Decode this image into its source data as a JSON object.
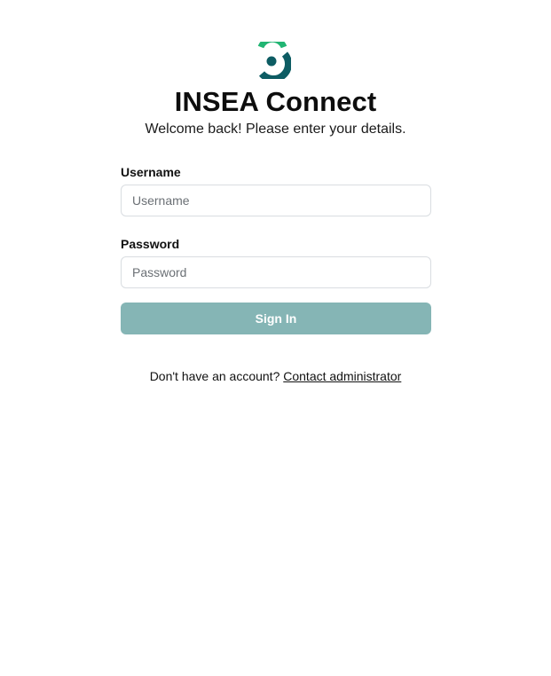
{
  "app": {
    "title": "INSEA Connect",
    "subtitle": "Welcome back! Please enter your details."
  },
  "logo": {
    "icon": "insea-logo-icon",
    "colors": {
      "accent": "#21b573",
      "primary": "#0d5c63"
    }
  },
  "form": {
    "username": {
      "label": "Username",
      "placeholder": "Username",
      "value": ""
    },
    "password": {
      "label": "Password",
      "placeholder": "Password",
      "value": ""
    },
    "submit": {
      "label": "Sign In",
      "color": "#85b5b5"
    }
  },
  "footer": {
    "prompt": "Don't have an account?",
    "link": "Contact administrator"
  }
}
